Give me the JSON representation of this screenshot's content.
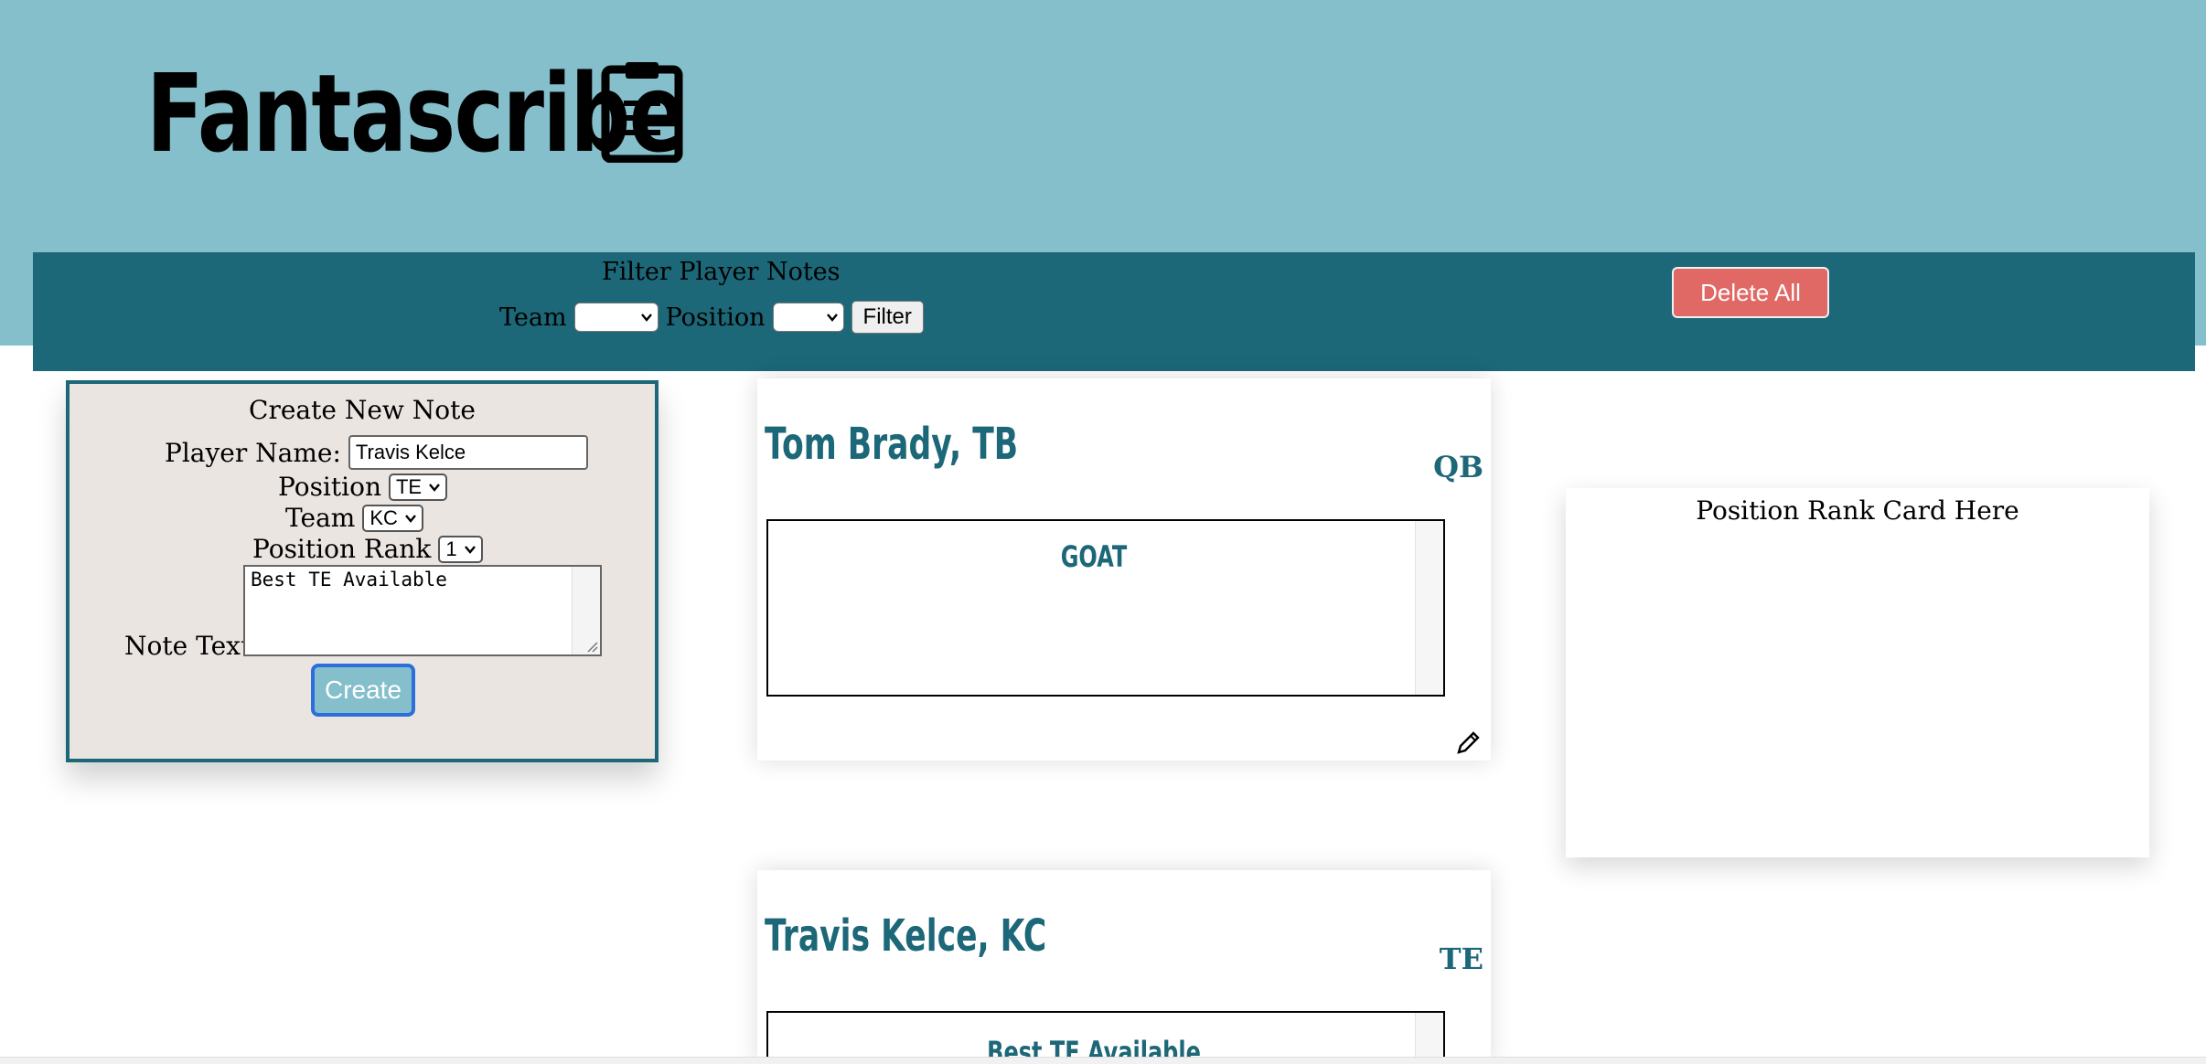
{
  "app": {
    "title": "Fantascribe",
    "icon": "clipboard-icon"
  },
  "filter": {
    "title": "Filter Player Notes",
    "team_label": "Team",
    "team_value": "",
    "position_label": "Position",
    "position_value": "",
    "filter_button": "Filter"
  },
  "delete_all_button": "Delete All",
  "create_note": {
    "title": "Create New Note",
    "player_name_label": "Player Name:",
    "player_name_value": "Travis Kelce",
    "position_label": "Position",
    "position_value": "TE",
    "team_label": "Team",
    "team_value": "KC",
    "position_rank_label": "Position Rank",
    "position_rank_value": "1",
    "note_text_label": "Note Text:",
    "note_text_value": "Best TE Available",
    "create_button": "Create"
  },
  "notes": [
    {
      "player": "Tom Brady, TB",
      "position": "QB",
      "note": "GOAT"
    },
    {
      "player": "Travis Kelce, KC",
      "position": "TE",
      "note": "Best TE Available"
    }
  ],
  "rank_card": {
    "title": "Position Rank Card Here"
  },
  "colors": {
    "header_bg": "#84bfcb",
    "bar_bg": "#1c6778",
    "accent": "#1c6778",
    "delete_bg": "#e06966",
    "panel_bg": "#ebe5e2"
  }
}
